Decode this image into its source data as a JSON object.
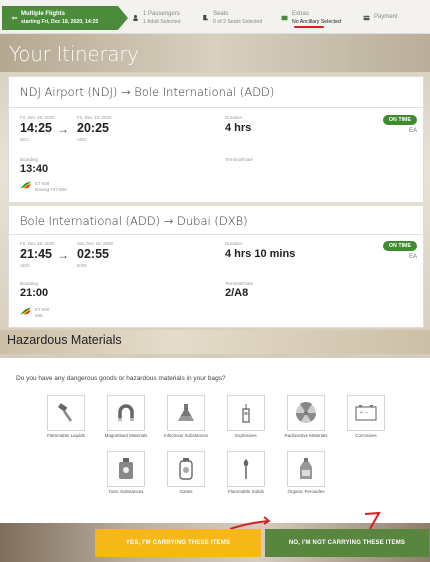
{
  "steps": [
    {
      "label1": "Multiple Flights",
      "label2": "starting Fri, Dec 18, 2020, 14:25",
      "icon": "plane-icon"
    },
    {
      "label1": "1 Passengers",
      "label2": "1 Adult Selected",
      "icon": "person-icon"
    },
    {
      "label1": "Seats",
      "label2": "0 of 2 Seats Selected",
      "icon": "seat-icon"
    },
    {
      "label1": "Extras",
      "label2": "No Ancillary Selected",
      "icon": "extras-icon"
    },
    {
      "label1": "Payment",
      "label2": "",
      "icon": "card-icon"
    }
  ],
  "page_title": "Your Itinerary",
  "flights": [
    {
      "route": "NDJ Airport (NDJ) → Bole International (ADD)",
      "dep_date": "Fri, Dec 18, 2020",
      "dep_time": "14:25",
      "dep_code": "NDJ",
      "arr_date": "Fri, Dec 18, 2020",
      "arr_time": "20:25",
      "arr_code": "ADD",
      "duration_label": "Duration",
      "duration": "4 hrs",
      "status": "ON TIME",
      "airline_code": "EA",
      "boarding_label": "Boarding",
      "boarding": "13:40",
      "terminal_label": "Terminal/Gate",
      "terminal": "",
      "flight_no": "ET 938",
      "aircraft": "Boeing 737-800"
    },
    {
      "route": "Bole International (ADD) → Dubai (DXB)",
      "dep_date": "Fri, Dec 18, 2020",
      "dep_time": "21:45",
      "dep_code": "ADD",
      "arr_date": "Sat, Dec 19, 2020",
      "arr_time": "02:55",
      "arr_code": "DXB",
      "duration_label": "Duration",
      "duration": "4 hrs 10 mins",
      "status": "ON TIME",
      "airline_code": "EA",
      "boarding_label": "Boarding",
      "boarding": "21:00",
      "terminal_label": "Terminal/Gate",
      "terminal": "2/A8",
      "flight_no": "ET 600",
      "aircraft": "888"
    }
  ],
  "hazard": {
    "title": "Hazardous Materials",
    "question": "Do you have any dangerous goods or hazardous materials in your bags?",
    "items": [
      {
        "name": "Flammable Liquids",
        "icon": "paintbrush-icon"
      },
      {
        "name": "Magnetised Materials",
        "icon": "magnet-icon"
      },
      {
        "name": "Infectious Substances",
        "icon": "flask-icon"
      },
      {
        "name": "Explosives",
        "icon": "firework-icon"
      },
      {
        "name": "Radioactive Materials",
        "icon": "radioactive-icon"
      },
      {
        "name": "Corrosives",
        "icon": "battery-icon"
      },
      {
        "name": "Toxic Substances",
        "icon": "toxic-bottle-icon"
      },
      {
        "name": "Gases",
        "icon": "gas-canister-icon"
      },
      {
        "name": "Flammable Solids",
        "icon": "match-icon"
      },
      {
        "name": "Organic Peroxides",
        "icon": "bottle-icon"
      }
    ]
  },
  "buttons": {
    "yes": "YES, I'M CARRYING THESE ITEMS",
    "no": "NO, I'M NOT CARRYING THESE ITEMS"
  },
  "colors": {
    "accent_green": "#4b8b3b",
    "button_yellow": "#f6b817",
    "button_green": "#59863f",
    "annotation_red": "#d62020"
  }
}
